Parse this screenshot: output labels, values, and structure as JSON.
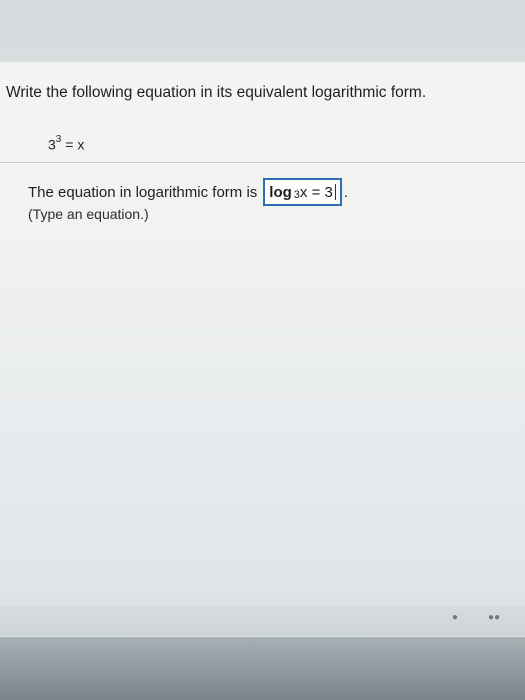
{
  "question": {
    "prompt": "Write the following equation in its equivalent logarithmic form."
  },
  "equation": {
    "base": "3",
    "exponent": "3",
    "rhs": "= x"
  },
  "answer": {
    "lead_text": "The equation in logarithmic form is",
    "log_word": "log",
    "log_base": "3",
    "log_rest": "x = 3",
    "period": "."
  },
  "hint": {
    "text": "(Type an equation.)"
  },
  "bottom": {
    "help_icon": "help-icon",
    "more_icon": "more-icon"
  }
}
